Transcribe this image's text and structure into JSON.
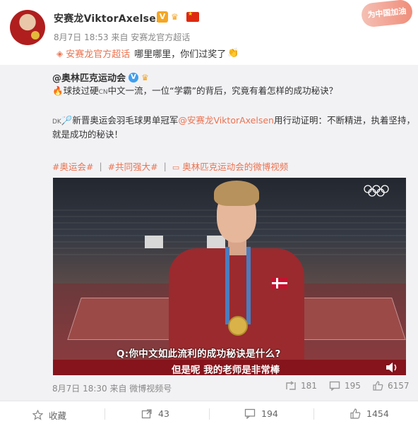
{
  "header": {
    "author": "安赛龙ViktorAxelsen",
    "meta": "8月7日 18:53 来自 安赛龙官方超话",
    "supertopic": "安赛龙官方超话",
    "comment": "哪里哪里，你们过奖了",
    "stamp": "为中国加油"
  },
  "original": {
    "author": "@奥林匹克运动会",
    "line1_prefix": "球技过硬",
    "line1_cn": "CN",
    "line1_rest": "中文一流，一位“学霸”的背后，究竟有着怎样的成功秘诀？",
    "line2_dk": "DK",
    "line2_prefix": "新晋奥运会羽毛球男单冠军",
    "line2_mention": "@安赛龙ViktorAxelsen",
    "line2_rest": "用行动证明：不断精进，执着坚持，",
    "line3": "就是成功的秘诀！",
    "tags": [
      "#奥运会#",
      "#共同强大#",
      "奥林匹克运动会的微博视频"
    ],
    "meta": "8月7日 18:30 来自 微博视频号",
    "reposts": "181",
    "comments": "195",
    "likes": "6157"
  },
  "video": {
    "question": "Q:你中文如此流利的成功秘诀是什么?",
    "answer": "但是呢 我的老师是非常棒"
  },
  "actions": {
    "favorite": "收藏",
    "repost": "43",
    "comment": "194",
    "like": "1454"
  },
  "colors": {
    "accent": "#eb7350",
    "subtitle_bar": "#85141c",
    "card_bg": "#f2f2f5"
  }
}
